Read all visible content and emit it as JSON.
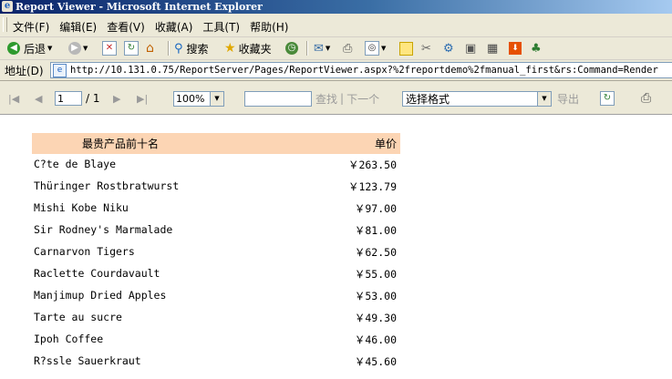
{
  "window": {
    "title": "Report Viewer - Microsoft Internet Explorer"
  },
  "menu": [
    "文件(F)",
    "编辑(E)",
    "查看(V)",
    "收藏(A)",
    "工具(T)",
    "帮助(H)"
  ],
  "toolbar": {
    "back": "后退",
    "search": "搜索",
    "favorites": "收藏夹"
  },
  "address": {
    "label": "地址(D)",
    "url": "http://10.131.0.75/ReportServer/Pages/ReportViewer.aspx?%2freportdemo%2fmanual_first&rs:Command=Render"
  },
  "viewer": {
    "page_value": "1",
    "page_total": "/ 1",
    "zoom": "100%",
    "find": "查找",
    "find_sep": "|",
    "next": "下一个",
    "format": "选择格式",
    "export": "导出"
  },
  "report": {
    "col_product": "最贵产品前十名",
    "col_price": "单价",
    "rows": [
      {
        "name": "C?te de Blaye",
        "price": "￥263.50"
      },
      {
        "name": "Thüringer Rostbratwurst",
        "price": "￥123.79"
      },
      {
        "name": "Mishi Kobe Niku",
        "price": "￥97.00"
      },
      {
        "name": "Sir Rodney's Marmalade",
        "price": "￥81.00"
      },
      {
        "name": "Carnarvon Tigers",
        "price": "￥62.50"
      },
      {
        "name": "Raclette Courdavault",
        "price": "￥55.00"
      },
      {
        "name": "Manjimup Dried Apples",
        "price": "￥53.00"
      },
      {
        "name": "Tarte au sucre",
        "price": "￥49.30"
      },
      {
        "name": "Ipoh Coffee",
        "price": "￥46.00"
      },
      {
        "name": "R?ssle Sauerkraut",
        "price": "￥45.60"
      }
    ]
  },
  "colors": {
    "header_bg": "#fcd5b4",
    "chrome": "#ece9d8",
    "title_bar": "#0a246a"
  }
}
